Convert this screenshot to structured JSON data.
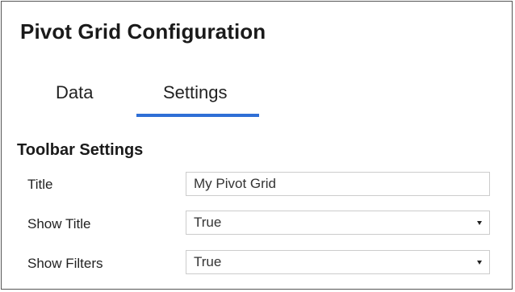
{
  "panel": {
    "title": "Pivot Grid Configuration"
  },
  "tabs": [
    {
      "label": "Data",
      "active": false
    },
    {
      "label": "Settings",
      "active": true
    }
  ],
  "accent_color": "#2f6fd6",
  "toolbar_settings": {
    "section_title": "Toolbar Settings",
    "title_field": {
      "label": "Title",
      "value": "My Pivot Grid"
    },
    "show_title": {
      "label": "Show Title",
      "value": "True"
    },
    "show_filters": {
      "label": "Show Filters",
      "value": "True"
    }
  },
  "icons": {
    "dropdown": "chevron-down-icon"
  }
}
